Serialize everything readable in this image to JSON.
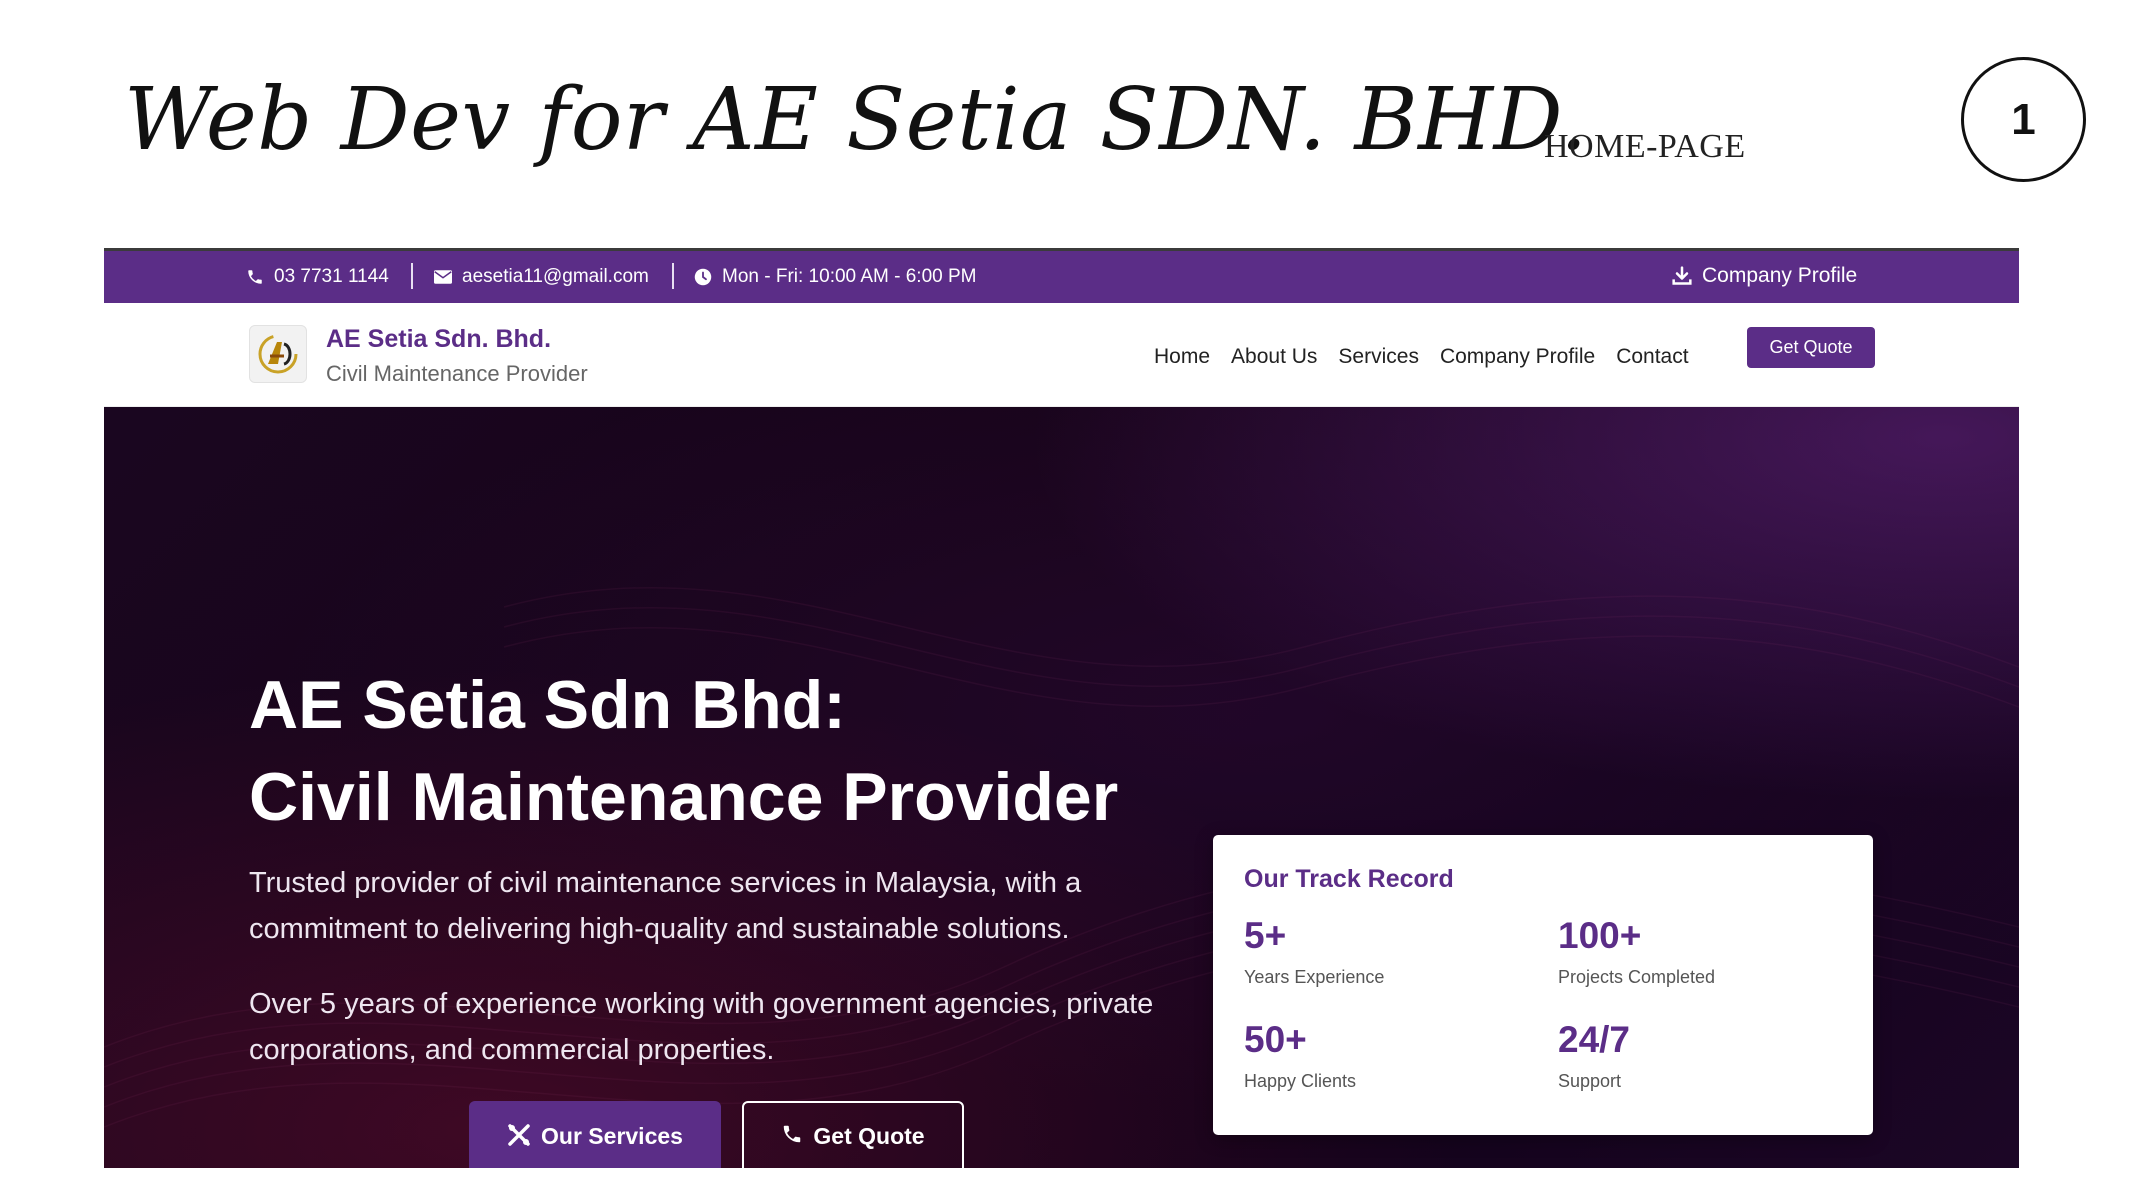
{
  "slide": {
    "title": "Web Dev for AE Setia SDN. BHD.",
    "subtitle": "HOME-PAGE",
    "page_number": "1"
  },
  "topbar": {
    "phone": "03 7731 1144",
    "email": "aesetia11@gmail.com",
    "hours": "Mon - Fri: 10:00 AM - 6:00 PM",
    "profile_link": "Company Profile"
  },
  "navbar": {
    "brand_name": "AE Setia Sdn. Bhd.",
    "brand_tagline": "Civil Maintenance Provider",
    "links": [
      "Home",
      "About Us",
      "Services",
      "Company Profile",
      "Contact"
    ],
    "cta": "Get Quote"
  },
  "hero": {
    "title_line1": "AE Setia Sdn Bhd:",
    "title_line2": "Civil Maintenance Provider",
    "paragraph1": "Trusted provider of civil maintenance services in Malaysia, with a commitment to delivering high-quality and sustainable solutions.",
    "paragraph2": "Over 5 years of experience working with government agencies, private corporations, and commercial properties.",
    "primary_button": "Our Services",
    "secondary_button": "Get Quote"
  },
  "track_record": {
    "title": "Our Track Record",
    "stats": [
      {
        "value": "5+",
        "label": "Years Experience"
      },
      {
        "value": "100+",
        "label": "Projects Completed"
      },
      {
        "value": "50+",
        "label": "Happy Clients"
      },
      {
        "value": "24/7",
        "label": "Support"
      }
    ]
  },
  "colors": {
    "brand_purple": "#5b2d87",
    "hero_dark": "#170419",
    "white": "#ffffff"
  }
}
